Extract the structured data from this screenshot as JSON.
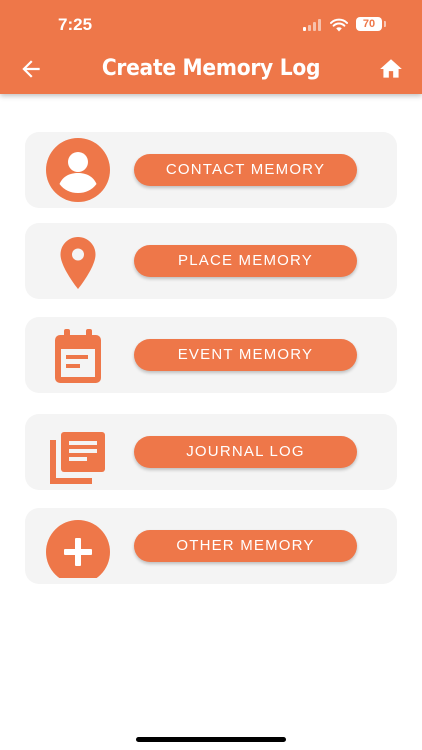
{
  "status_bar": {
    "time": "7:25",
    "battery": "70"
  },
  "header": {
    "title": "Create Memory Log",
    "back_icon": "arrow-left-icon",
    "home_icon": "home-icon"
  },
  "colors": {
    "accent": "#EE7749",
    "card_background": "#F4F4F4",
    "page_background": "#FFFFFF"
  },
  "options": [
    {
      "label": "CONTACT MEMORY",
      "icon": "account-circle-icon"
    },
    {
      "label": "PLACE MEMORY",
      "icon": "map-pin-icon"
    },
    {
      "label": "EVENT MEMORY",
      "icon": "calendar-icon"
    },
    {
      "label": "JOURNAL LOG",
      "icon": "library-books-icon"
    },
    {
      "label": "OTHER MEMORY",
      "icon": "add-circle-icon"
    }
  ]
}
